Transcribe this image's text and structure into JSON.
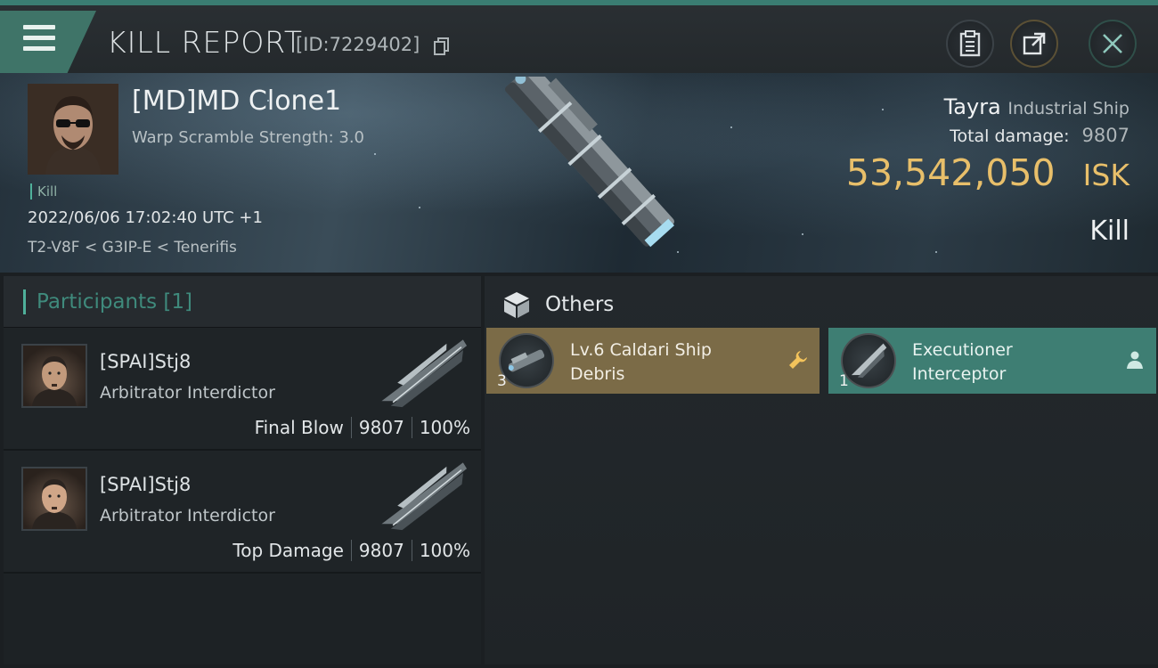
{
  "header": {
    "title": "KILL REPORT",
    "kill_id": "[ID:7229402]"
  },
  "victim": {
    "name": "[MD]MD Clone1",
    "warp_scramble": "Warp Scramble Strength: 3.0",
    "tag": "Kill",
    "timestamp": "2022/06/06 17:02:40 UTC +1",
    "location": "T2-V8F < G3IP-E < Tenerifis",
    "ship_name": "Tayra",
    "ship_class": "Industrial Ship",
    "total_damage_label": "Total damage:",
    "total_damage": "9807",
    "isk_value": "53,542,050",
    "isk_unit": "ISK",
    "result": "Kill"
  },
  "participants": {
    "header": "Participants [1]",
    "rows": [
      {
        "name": "[SPAI]Stj8",
        "ship": "Arbitrator Interdictor",
        "role": "Final Blow",
        "damage": "9807",
        "percent": "100%"
      },
      {
        "name": "[SPAI]Stj8",
        "ship": "Arbitrator Interdictor",
        "role": "Top Damage",
        "damage": "9807",
        "percent": "100%"
      }
    ]
  },
  "others": {
    "title": "Others",
    "items": [
      {
        "name_line1": "Lv.6 Caldari Ship",
        "name_line2": "Debris",
        "qty": "3",
        "badge": "wrench-icon",
        "color": "#7b6b47"
      },
      {
        "name_line1": "Executioner",
        "name_line2": "Interceptor",
        "qty": "1",
        "badge": "pilot-icon",
        "color": "#3e7e73"
      }
    ]
  },
  "colors": {
    "accent": "#3f7468",
    "isk": "#e8bf6a",
    "participants_header": "#3f8a7c"
  }
}
